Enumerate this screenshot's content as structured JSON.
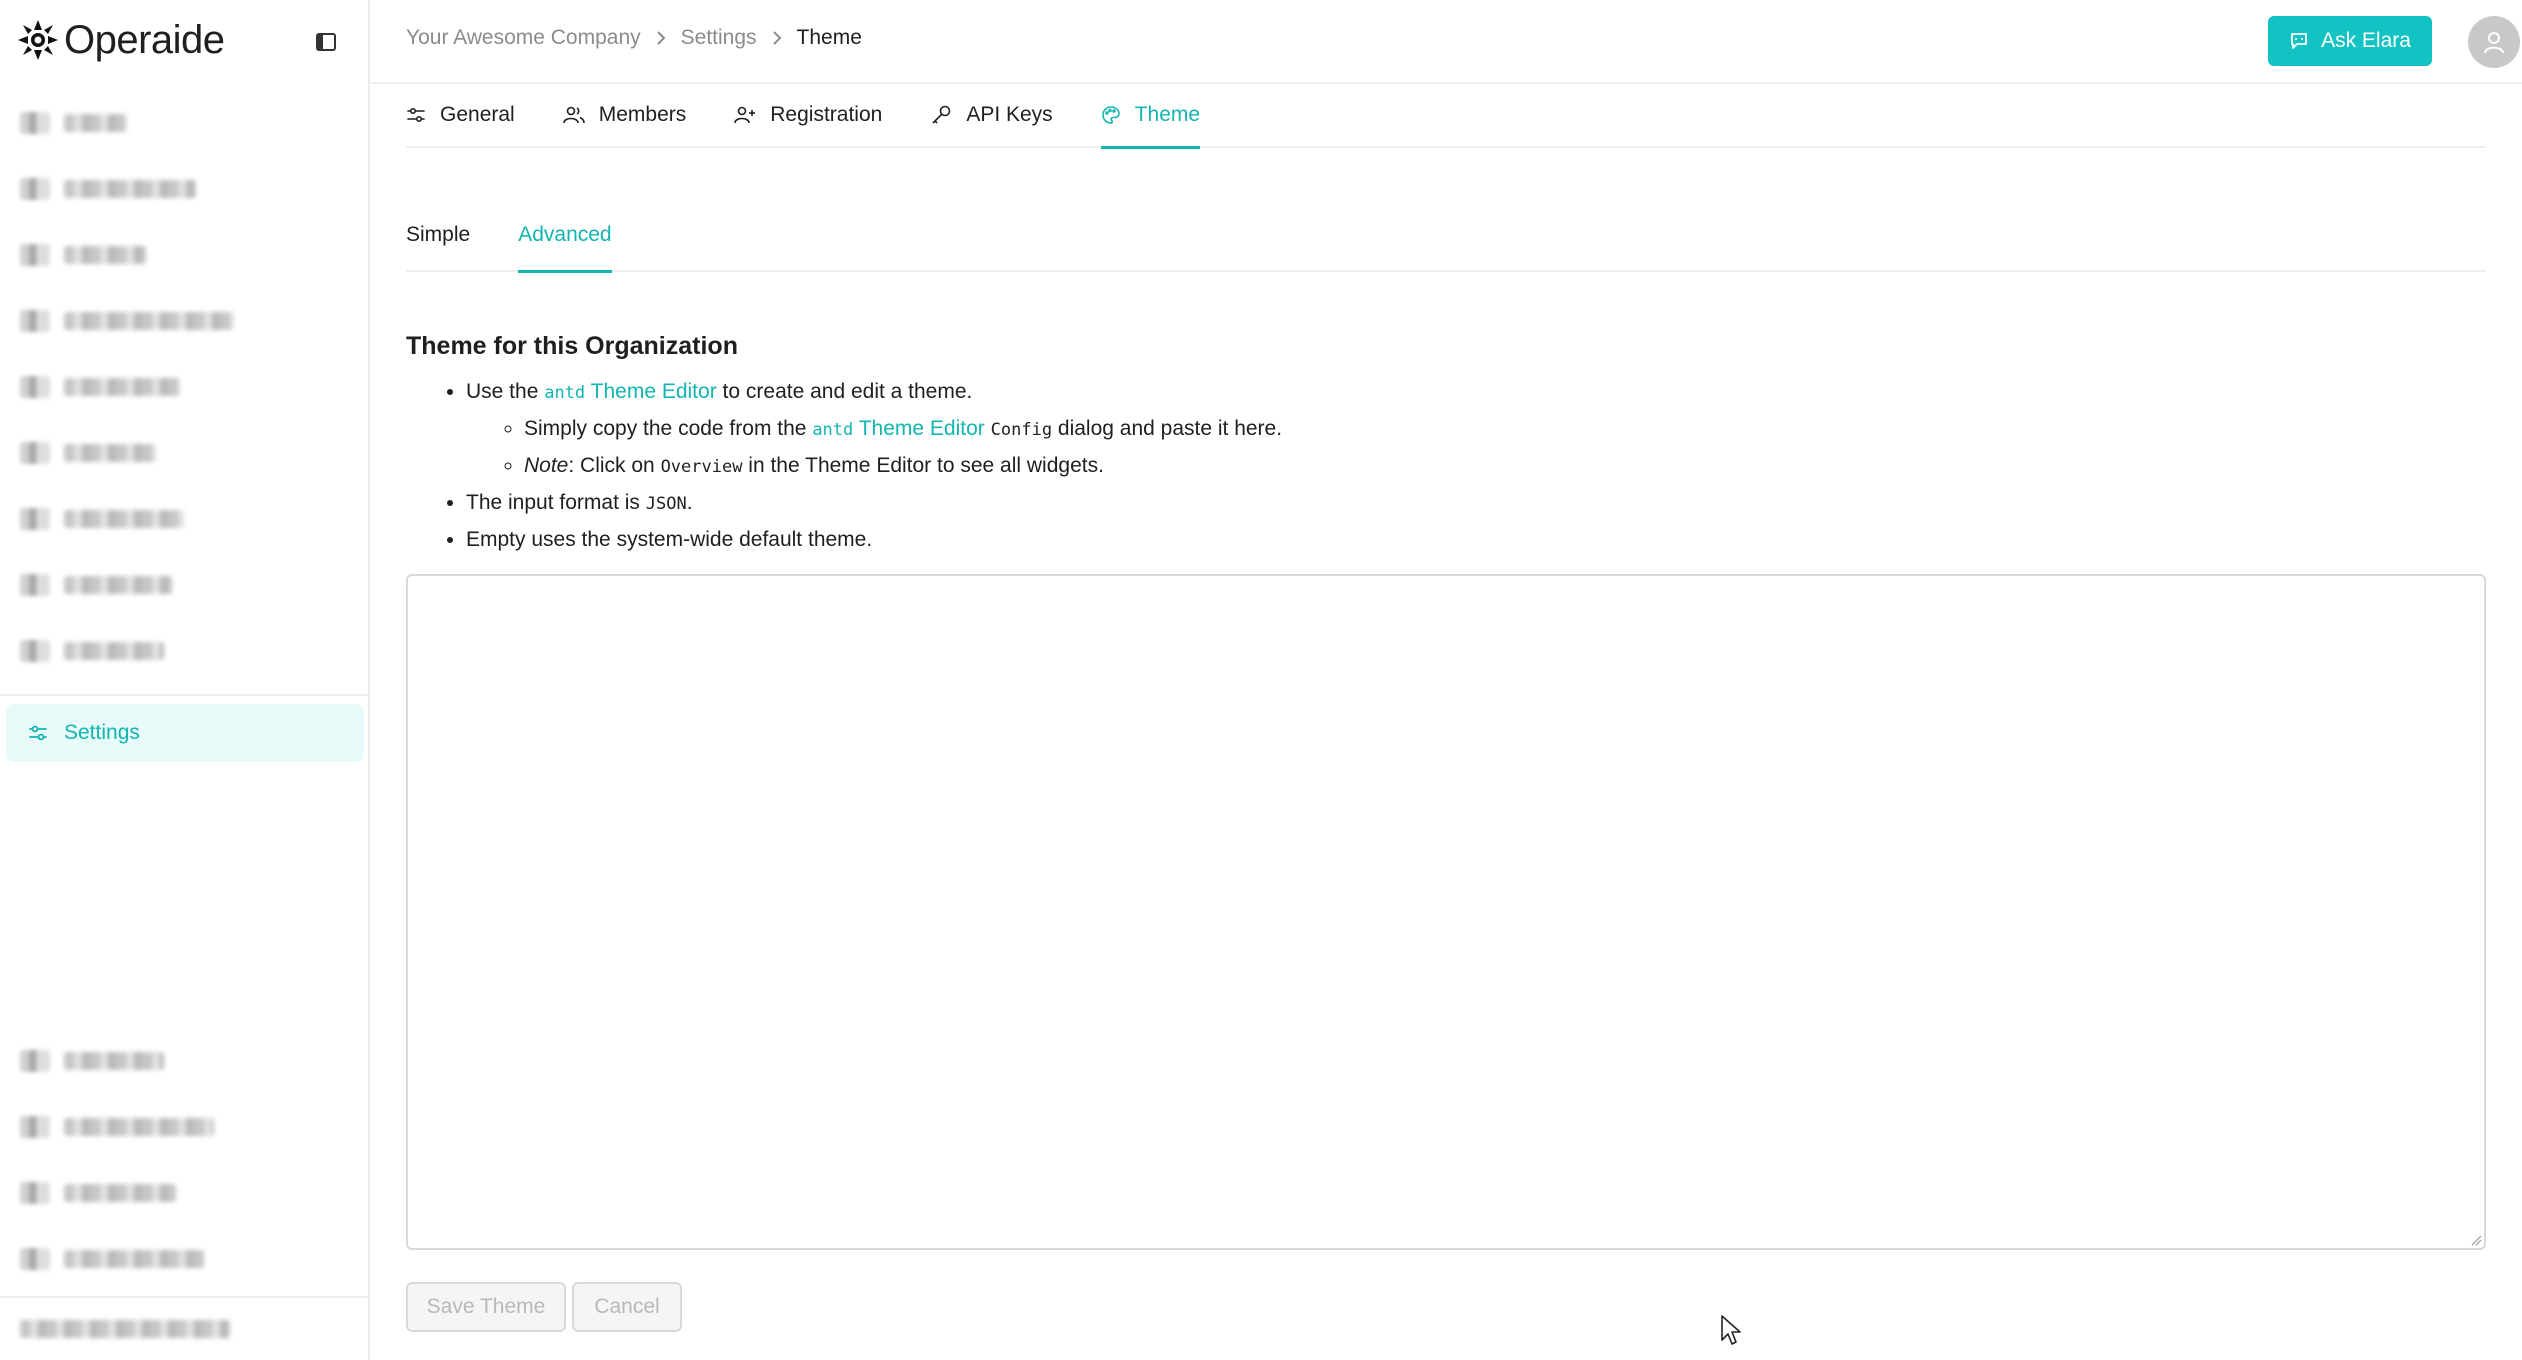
{
  "brand": {
    "name": "Operaide"
  },
  "sidebar": {
    "active_item": {
      "label": "Settings",
      "icon": "sliders-icon"
    },
    "colors": {
      "active_bg": "#e6fbfa",
      "active_text": "#13b5b0"
    }
  },
  "breadcrumb": {
    "items": [
      "Your Awesome Company",
      "Settings",
      "Theme"
    ]
  },
  "header": {
    "ask_button": "Ask Elara",
    "accent": "#13c2c2"
  },
  "tabs": [
    {
      "label": "General",
      "icon": "sliders-icon"
    },
    {
      "label": "Members",
      "icon": "users-icon"
    },
    {
      "label": "Registration",
      "icon": "user-add-icon"
    },
    {
      "label": "API Keys",
      "icon": "key-icon"
    },
    {
      "label": "Theme",
      "icon": "palette-icon",
      "active": true
    }
  ],
  "subtabs": [
    {
      "label": "Simple"
    },
    {
      "label": "Advanced",
      "active": true
    }
  ],
  "content": {
    "title": "Theme for this Organization",
    "bullet1": {
      "prefix": "Use the",
      "code": "antd",
      "link": "Theme Editor",
      "suffix": "to create and edit a theme."
    },
    "sub1": {
      "prefix": "Simply copy the code from the",
      "code": "antd",
      "link": "Theme Editor",
      "code2": "Config",
      "suffix": "dialog and paste it here."
    },
    "sub2": {
      "note": "Note",
      "prefix": ": Click on",
      "code": "Overview",
      "suffix": "in the Theme Editor to see all widgets."
    },
    "bullet2": {
      "prefix": "The input format is",
      "code": "JSON",
      "suffix": "."
    },
    "bullet3": "Empty uses the system-wide default theme.",
    "editor_value": ""
  },
  "actions": {
    "save": "Save Theme",
    "cancel": "Cancel"
  }
}
